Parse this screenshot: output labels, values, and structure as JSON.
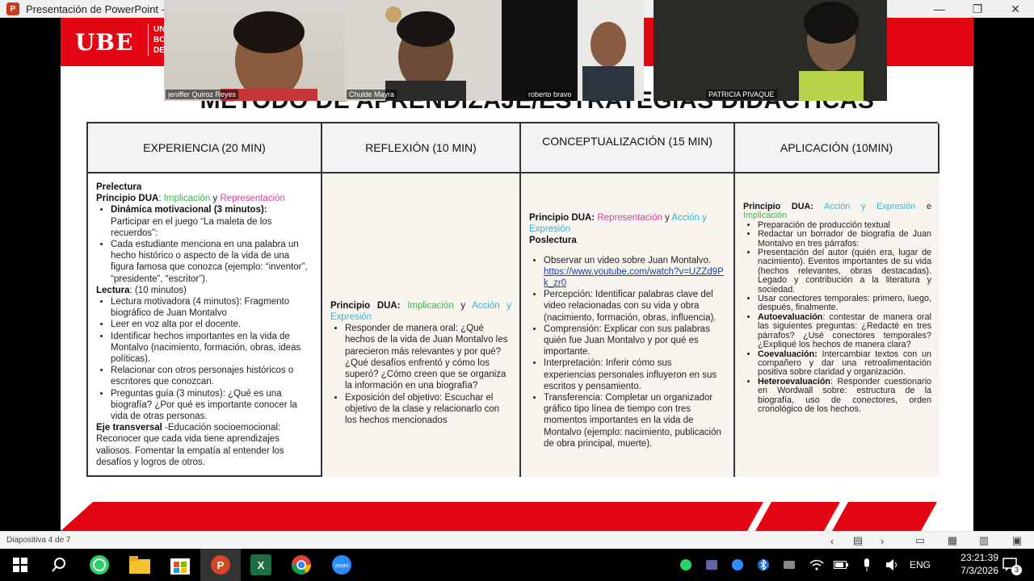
{
  "window": {
    "title": "Presentación de PowerPoint - [L",
    "minimize": "—",
    "restore": "❐",
    "close": "✕"
  },
  "slide": {
    "logo": "UBE",
    "logo_sub": [
      "UNI",
      "BOL",
      "DEL"
    ],
    "title": "MÉTODO DE APRENDIZAJE/ESTRATEGIAS DIDÁCTICAS",
    "headers": [
      "EXPERIENCIA (20 MIN)",
      "REFLEXIÓN (10 MIN)",
      "CONCEPTUALIZACIÓN (15 MIN)",
      "APLICACIÓN (10MIN)"
    ],
    "col1": {
      "prelectura": "Prelectura",
      "principio_label": "Principio DUA",
      "principio_sep": ": ",
      "implicacion": "Implicación",
      "y": " y ",
      "representacion": "Representación",
      "dinamica_title": "Dinámica motivacional (3 minutos):",
      "dinamica_text": "Participar en el juego “La maleta de los recuerdos”:",
      "item_estudiante": "Cada estudiante menciona en una palabra un hecho histórico o aspecto de la vida de una figura famosa que conozca (ejemplo: “inventor”, “presidente”, “escritor”).",
      "lectura_label": "Lectura",
      "lectura_time": ": (10 minutos)",
      "lectura_items": [
        "Lectura motivadora (4 minutos): Fragmento biográfico de Juan Montalvo",
        "Leer en voz alta por el docente.",
        "Identificar hechos importantes en la vida de Montalvo (nacimiento, formación, obras, ideas políticas).",
        "Relacionar con otros personajes históricos o escritores que conozcan.",
        "Preguntas guía (3 minutos): ¿Qué es una biografía? ¿Por qué es importante conocer la vida de otras personas."
      ],
      "eje_label": "Eje transversal",
      "eje_text": " -Educación socioemocional: Reconocer que cada vida tiene aprendizajes valiosos. Fomentar la empatía al entender los desafíos y logros de otros."
    },
    "col2": {
      "principio_label": "Principio DUA:",
      "implicacion": "Implicación",
      "y": " y ",
      "accion": "Acción y Expresión",
      "items": [
        "Responder de manera oral: ¿Qué hechos de la vida de Juan Montalvo les parecieron más relevantes y por qué? ¿Qué desafíos enfrentó y cómo los superó? ¿Cómo creen que se organiza la información en una biografía?",
        "Exposición del objetivo: Escuchar el objetivo de la clase y relacionarlo con los hechos mencionados"
      ]
    },
    "col3": {
      "principio_label": "Principio DUA:",
      "representacion": "Representación",
      "y": " y ",
      "accion": "Acción y Expresión",
      "poslectura": "Poslectura",
      "video_text": "Observar un video sobre Juan Montalvo.",
      "video_link": "https://www.youtube.com/watch?v=UZZd9Pk_zr0",
      "items": [
        "Percepción: Identificar palabras clave del video relacionadas con su vida y obra (nacimiento, formación, obras, influencia).",
        "Comprensión: Explicar con sus palabras quién fue Juan Montalvo y por qué es importante.",
        "Interpretación: Inferir cómo sus experiencias personales influyeron en sus escritos y pensamiento.",
        "Transferencia: Completar un organizador gráfico tipo línea de tiempo con tres momentos importantes en la vida de Montalvo (ejemplo: nacimiento, publicación de obra principal, muerte)."
      ]
    },
    "col4": {
      "principio_label": "Principio DUA:",
      "accion": "Acción y Expresión",
      "e": " e ",
      "implicacion": "Implicación",
      "items": [
        "Preparación de producción textual",
        "Redactar un borrador de biografía de Juan Montalvo en tres párrafos:",
        "Presentación del autor (quién era, lugar de nacimiento). Eventos importantes de su vida (hechos relevantes, obras destacadas). Legado y contribución a la literatura y sociedad.",
        "Usar conectores temporales: primero, luego, después, finalmente."
      ],
      "auto_label": "Autoevaluación",
      "auto_text": ": contestar de manera oral las siguientes preguntas: ¿Redacté en tres párrafos? ¿Usé conectores temporales? ¿Expliqué los hechos de manera clara?",
      "co_label": "Coevaluación:",
      "co_text": " Intercambiar textos con un compañero y dar una retroalimentación positiva sobre claridad y organización.",
      "hetero_label": "Heteroevaluación",
      "hetero_text": ": Responder cuestionario en Wordwall sobre: estructura de la biografía, uso de conectores, orden cronológico de los hechos."
    }
  },
  "participants": [
    "jeniffer Quiroz Reyes",
    "Chulde Mayra",
    "roberto bravo",
    "PATRICIA PIVAQUE"
  ],
  "statusbar": {
    "slide_indicator": "Diapositiva 4 de 7"
  },
  "taskbar": {
    "lang": "ENG",
    "time": "23:21:39",
    "date": "7/3/2026",
    "notifications": "3",
    "zoom_label": "zoom"
  }
}
